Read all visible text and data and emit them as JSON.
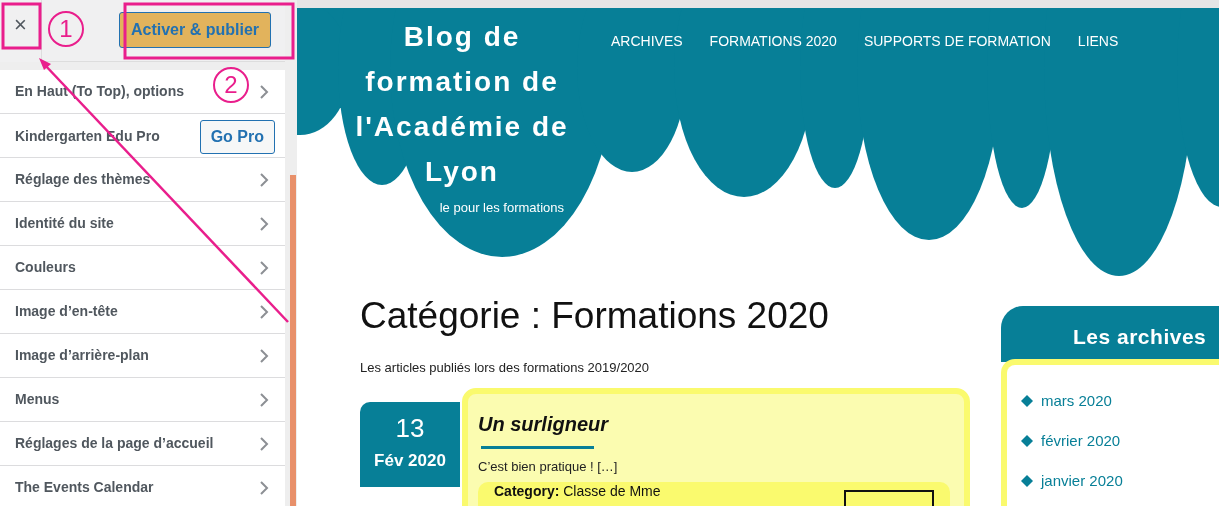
{
  "customizer": {
    "close_label": "×",
    "publish_button": "Activer & publier",
    "sections": [
      {
        "kind": "link",
        "label": "En Haut (To Top), options"
      },
      {
        "kind": "promo",
        "label": "Kindergarten Edu Pro",
        "button": "Go Pro"
      },
      {
        "kind": "link",
        "label": "Réglage des thèmes"
      },
      {
        "kind": "link",
        "label": "Identité du site"
      },
      {
        "kind": "link",
        "label": "Couleurs"
      },
      {
        "kind": "link",
        "label": "Image d’en-tête"
      },
      {
        "kind": "link",
        "label": "Image d’arrière-plan"
      },
      {
        "kind": "link",
        "label": "Menus"
      },
      {
        "kind": "link",
        "label": "Réglages de la page d’accueil"
      },
      {
        "kind": "link",
        "label": "The Events Calendar"
      }
    ]
  },
  "annotations": [
    {
      "label": "1"
    },
    {
      "label": "2"
    }
  ],
  "site": {
    "title": "Blog de formation de l'Académie de Lyon",
    "tagline": "le pour les formations",
    "menu": [
      "ARCHIVES",
      "FORMATIONS 2020",
      "SUPPORTS DE FORMATION",
      "LIENS"
    ]
  },
  "archive": {
    "heading": "Catégorie : Formations 2020",
    "description": "Les articles publiés lors des formations 2019/2020",
    "posts": [
      {
        "day": "13",
        "month": "Fév 2020",
        "title": "Un surligneur",
        "excerpt": "C’est bien pratique ! […]",
        "meta_label": "Category:",
        "meta_value": "Classe de Mme"
      }
    ]
  },
  "sidebar": {
    "title": "Les archives",
    "links": [
      "mars 2020",
      "février 2020",
      "janvier 2020"
    ]
  }
}
